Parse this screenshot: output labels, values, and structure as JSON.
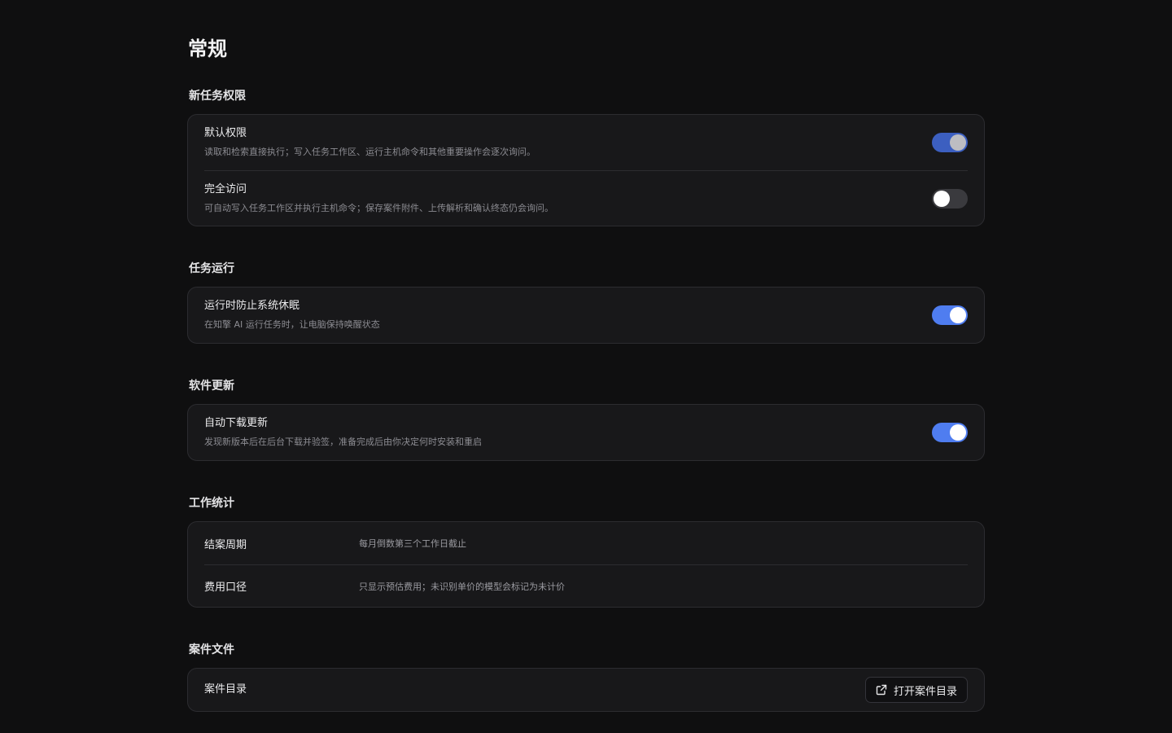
{
  "page": {
    "title": "常规"
  },
  "sections": {
    "permissions": {
      "title": "新任务权限",
      "default": {
        "label": "默认权限",
        "description": "读取和检索直接执行；写入任务工作区、运行主机命令和其他重要操作会逐次询问。",
        "enabled": true
      },
      "full": {
        "label": "完全访问",
        "description": "可自动写入任务工作区并执行主机命令；保存案件附件、上传解析和确认终态仍会询问。",
        "enabled": false
      }
    },
    "run": {
      "title": "任务运行",
      "sleep": {
        "label": "运行时防止系统休眠",
        "description": "在知擎 AI 运行任务时，让电脑保持唤醒状态",
        "enabled": true
      }
    },
    "update": {
      "title": "软件更新",
      "auto": {
        "label": "自动下载更新",
        "description": "发现新版本后在后台下载并验签，准备完成后由你决定何时安装和重启",
        "enabled": true
      }
    },
    "stats": {
      "title": "工作统计",
      "rows": [
        {
          "key": "结案周期",
          "value": "每月倒数第三个工作日截止"
        },
        {
          "key": "费用口径",
          "value": "只显示预估费用；未识别单价的模型会标记为未计价"
        }
      ]
    },
    "files": {
      "title": "案件文件",
      "dir_label": "案件目录",
      "open_button": "打开案件目录"
    }
  },
  "colors": {
    "background": "#0f0f10",
    "card": "#18181a",
    "accent": "#4f7df0",
    "toggle_off": "#3a3a3e"
  },
  "icons": {
    "open_button_icon": "external-link-icon"
  }
}
